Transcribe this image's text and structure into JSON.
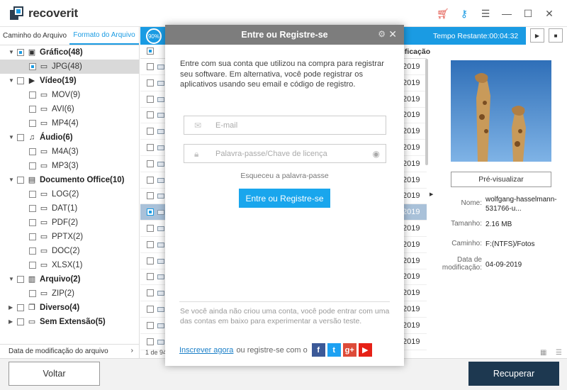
{
  "app": {
    "name": "recoverit",
    "colors": {
      "accent": "#1a9be3",
      "primary_button": "#1d3850",
      "cta": "#19a6ed"
    }
  },
  "window_icons": [
    "cart-icon",
    "key-icon",
    "menu-icon",
    "minimize-icon",
    "maximize-icon",
    "close-icon"
  ],
  "sidebar": {
    "tabs": [
      {
        "label": "Caminho do Arquivo",
        "active": false
      },
      {
        "label": "Formato do Arquivo",
        "active": true
      }
    ],
    "tree": [
      {
        "label": "Gráfico(48)",
        "level": 0,
        "category": true,
        "expanded": true,
        "checkbox": "partial",
        "icon": "graphic-icon"
      },
      {
        "label": "JPG(48)",
        "level": 1,
        "category": false,
        "checkbox": "partial",
        "selected": true,
        "icon": "folder-icon"
      },
      {
        "label": "Vídeo(19)",
        "level": 0,
        "category": true,
        "expanded": true,
        "checkbox": "none",
        "icon": "video-icon"
      },
      {
        "label": "MOV(9)",
        "level": 1,
        "checkbox": "none",
        "icon": "folder-icon"
      },
      {
        "label": "AVI(6)",
        "level": 1,
        "checkbox": "none",
        "icon": "folder-icon"
      },
      {
        "label": "MP4(4)",
        "level": 1,
        "checkbox": "none",
        "icon": "folder-icon"
      },
      {
        "label": "Áudio(6)",
        "level": 0,
        "category": true,
        "expanded": true,
        "checkbox": "none",
        "icon": "audio-icon"
      },
      {
        "label": "M4A(3)",
        "level": 1,
        "checkbox": "none",
        "icon": "folder-icon"
      },
      {
        "label": "MP3(3)",
        "level": 1,
        "checkbox": "none",
        "icon": "folder-icon"
      },
      {
        "label": "Documento Office(10)",
        "level": 0,
        "category": true,
        "expanded": true,
        "checkbox": "none",
        "icon": "document-icon"
      },
      {
        "label": "LOG(2)",
        "level": 1,
        "checkbox": "none",
        "icon": "folder-icon"
      },
      {
        "label": "DAT(1)",
        "level": 1,
        "checkbox": "none",
        "icon": "folder-icon"
      },
      {
        "label": "PDF(2)",
        "level": 1,
        "checkbox": "none",
        "icon": "folder-icon"
      },
      {
        "label": "PPTX(2)",
        "level": 1,
        "checkbox": "none",
        "icon": "folder-icon"
      },
      {
        "label": "DOC(2)",
        "level": 1,
        "checkbox": "none",
        "icon": "folder-icon"
      },
      {
        "label": "XLSX(1)",
        "level": 1,
        "checkbox": "none",
        "icon": "folder-icon"
      },
      {
        "label": "Arquivo(2)",
        "level": 0,
        "category": true,
        "expanded": true,
        "checkbox": "none",
        "icon": "archive-icon"
      },
      {
        "label": "ZIP(2)",
        "level": 1,
        "checkbox": "none",
        "icon": "folder-icon"
      },
      {
        "label": "Diverso(4)",
        "level": 0,
        "category": true,
        "expanded": false,
        "checkbox": "none",
        "icon": "misc-icon"
      },
      {
        "label": "Sem Extensão(5)",
        "level": 0,
        "category": true,
        "expanded": false,
        "checkbox": "none",
        "icon": "folder-icon"
      }
    ],
    "footer": "Data de modificação do arquivo"
  },
  "toolbar": {
    "progress": "90%",
    "progress_fraction": 0.9,
    "time_remaining": "Tempo Restante:00:04:32"
  },
  "file_list": {
    "column_header": "ificação",
    "rows": [
      {
        "year": "2019",
        "checked": false,
        "selected": false
      },
      {
        "year": "2019",
        "checked": false,
        "selected": false
      },
      {
        "year": "2019",
        "checked": false,
        "selected": false
      },
      {
        "year": "2019",
        "checked": false,
        "selected": false
      },
      {
        "year": "2019",
        "checked": false,
        "selected": false
      },
      {
        "year": "2019",
        "checked": false,
        "selected": false
      },
      {
        "year": "2019",
        "checked": false,
        "selected": false
      },
      {
        "year": "2019",
        "checked": false,
        "selected": false
      },
      {
        "year": "2019",
        "checked": false,
        "selected": false
      },
      {
        "year": "2019",
        "checked": true,
        "selected": true
      },
      {
        "year": "2019",
        "checked": false,
        "selected": false
      },
      {
        "year": "2019",
        "checked": false,
        "selected": false
      },
      {
        "year": "2019",
        "checked": false,
        "selected": false
      },
      {
        "year": "2019",
        "checked": false,
        "selected": false
      },
      {
        "year": "2019",
        "checked": false,
        "selected": false
      },
      {
        "year": "2019",
        "checked": false,
        "selected": false
      },
      {
        "year": "2019",
        "checked": false,
        "selected": false
      },
      {
        "year": "2019",
        "checked": false,
        "selected": false
      }
    ],
    "page_count": "1 de 94"
  },
  "preview": {
    "button_label": "Pré-visualizar",
    "meta": [
      {
        "label": "Nome:",
        "value": "wolfgang-hasselmann-531766-u..."
      },
      {
        "label": "Tamanho:",
        "value": "2.16  MB"
      },
      {
        "label": "Caminho:",
        "value": "F:(NTFS)/Fotos"
      },
      {
        "label": "Data de modificação:",
        "value": "04-09-2019"
      }
    ]
  },
  "bottom": {
    "back_label": "Voltar",
    "recover_label": "Recuperar"
  },
  "modal": {
    "title": "Entre ou Registre-se",
    "description": "Entre com sua conta que utilizou na compra para registrar seu software. Em alternativa, você pode registrar os aplicativos usando seu email e código de registro.",
    "email_placeholder": "E-mail",
    "password_placeholder": "Palavra-passe/Chave de licença",
    "forgot_password": "Esqueceu a palavra-passe",
    "login_button": "Entre ou Registre-se",
    "trial_text": "Se você ainda não criou uma conta, você pode entrar com uma das contas em baixo para experimentar a versão teste.",
    "signup_link": "Inscrever agora",
    "social_text": "ou registre-se com o",
    "social": [
      {
        "name": "facebook-icon",
        "glyph": "f"
      },
      {
        "name": "twitter-icon",
        "glyph": "t"
      },
      {
        "name": "google-plus-icon",
        "glyph": "g+"
      },
      {
        "name": "youtube-icon",
        "glyph": "▶"
      }
    ]
  }
}
